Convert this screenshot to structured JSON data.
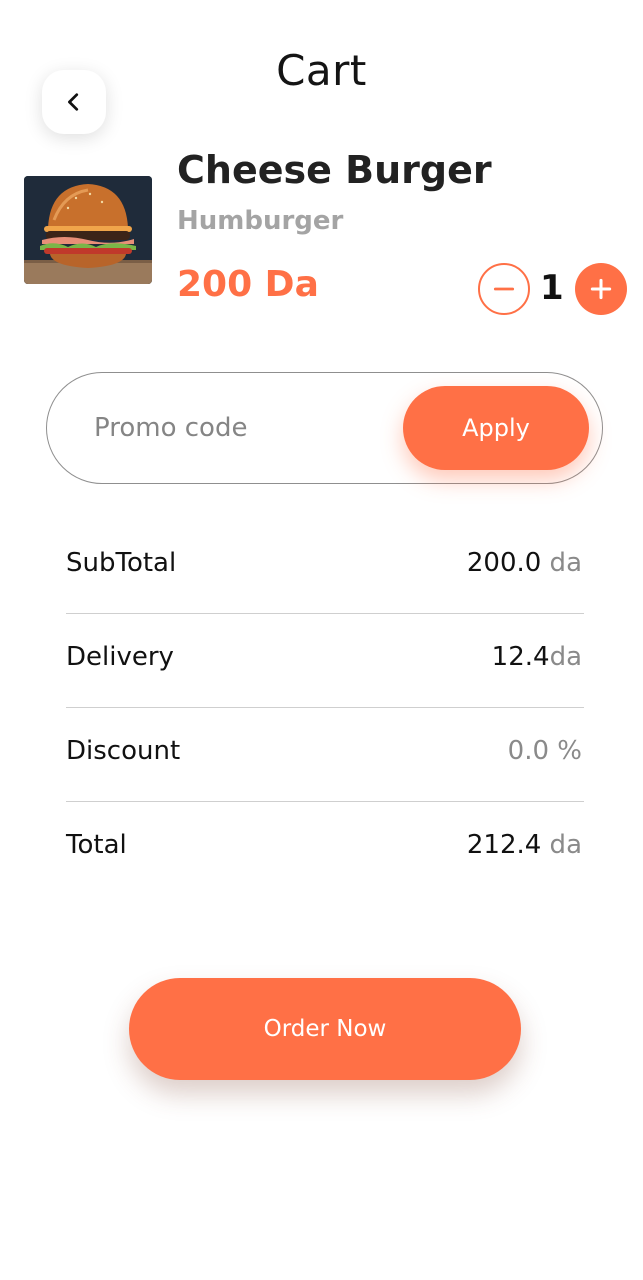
{
  "header": {
    "title": "Cart"
  },
  "item": {
    "name": "Cheese Burger",
    "category": "Humburger",
    "price": "200 Da",
    "quantity": "1"
  },
  "promo": {
    "placeholder": "Promo code",
    "apply_label": "Apply"
  },
  "summary": {
    "subtotal": {
      "label": "SubTotal",
      "amount": "200.0",
      "unit": " da"
    },
    "delivery": {
      "label": "Delivery",
      "amount": "12.4",
      "unit": "da"
    },
    "discount": {
      "label": "Discount",
      "value": "0.0 %"
    },
    "total": {
      "label": "Total",
      "amount": "212.4",
      "unit": " da"
    }
  },
  "order_button": {
    "label": "Order Now"
  },
  "colors": {
    "accent": "#ff7046",
    "muted": "#8a8a8a",
    "text": "#111111"
  },
  "icons": [
    "chevron-left-icon",
    "minus-icon",
    "plus-icon"
  ]
}
